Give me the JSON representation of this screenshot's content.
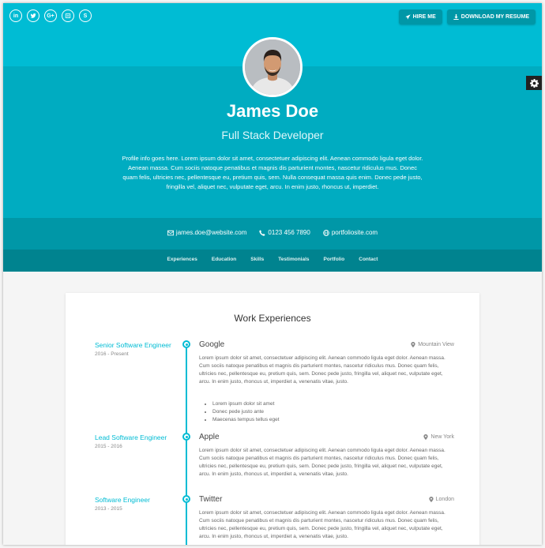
{
  "social": {
    "icons": [
      "linkedin-icon",
      "twitter-icon",
      "google-plus-icon",
      "stack-overflow-icon",
      "skype-icon"
    ]
  },
  "header_buttons": {
    "hire_me": "HIRE ME",
    "download": "DOWNLOAD MY RESUME"
  },
  "profile": {
    "name": "James Doe",
    "title": "Full Stack Developer",
    "bio": "Profile info goes here. Lorem ipsum dolor sit amet, consectetuer adipiscing elit. Aenean commodo ligula eget dolor. Aenean massa. Cum sociis natoque penatibus et magnis dis parturient montes, nascetur ridiculus mus. Donec quam felis, ultricies nec, pellentesque eu, pretium quis, sem. Nulla consequat massa quis enim. Donec pede justo, fringilla vel, aliquet nec, vulputate eget, arcu. In enim justo, rhoncus ut, imperdiet."
  },
  "contact": {
    "email": "james.doe@website.com",
    "phone": "0123 456 7890",
    "website": "portfoliosite.com"
  },
  "nav": {
    "items": [
      "Experiences",
      "Education",
      "Skills",
      "Testimonials",
      "Portfolio",
      "Contact"
    ]
  },
  "section": {
    "title": "Work Experiences"
  },
  "experiences": [
    {
      "title": "Senior Software Engineer",
      "period": "2016 - Present",
      "company": "Google",
      "location": "Mountain View",
      "description": "Lorem ipsum dolor sit amet, consectetuer adipiscing elit. Aenean commodo ligula eget dolor. Aenean massa. Cum sociis natoque penatibus et magnis dis parturient montes, nascetur ridiculus mus. Donec quam felis, ultricies nec, pellentesque eu, pretium quis, sem. Donec pede justo, fringilla vel, aliquet nec, vulputate eget, arcu. In enim justo, rhoncus ut, imperdiet a, venenatis vitae, justo.",
      "bullets": [
        "Lorem ipsum dolor sit amet",
        "Donec pede justo ante",
        "Maecenas tempus tellus eget"
      ]
    },
    {
      "title": "Lead Software Engineer",
      "period": "2015 - 2016",
      "company": "Apple",
      "location": "New York",
      "description": "Lorem ipsum dolor sit amet, consectetuer adipiscing elit. Aenean commodo ligula eget dolor. Aenean massa. Cum sociis natoque penatibus et magnis dis parturient montes, nascetur ridiculus mus. Donec quam felis, ultricies nec, pellentesque eu, pretium quis, sem. Donec pede justo, fringilla vel, aliquet nec, vulputate eget, arcu. In enim justo, rhoncus ut, imperdiet a, venenatis vitae, justo."
    },
    {
      "title": "Software Engineer",
      "period": "2013 - 2015",
      "company": "Twitter",
      "location": "London",
      "description": "Lorem ipsum dolor sit amet, consectetuer adipiscing elit. Aenean commodo ligula eget dolor. Aenean massa. Cum sociis natoque penatibus et magnis dis parturient montes, nascetur ridiculus mus. Donec quam felis, ultricies nec, pellentesque eu, pretium quis, sem. Donec pede justo, fringilla vel, aliquet nec, vulputate eget, arcu. In enim justo, rhoncus ut, imperdiet a, venenatis vitae, justo."
    }
  ],
  "colors": {
    "accent": "#00bcd4",
    "header_mid": "#00acc1",
    "contact_band": "#0097a7",
    "nav_band": "#00838f"
  }
}
